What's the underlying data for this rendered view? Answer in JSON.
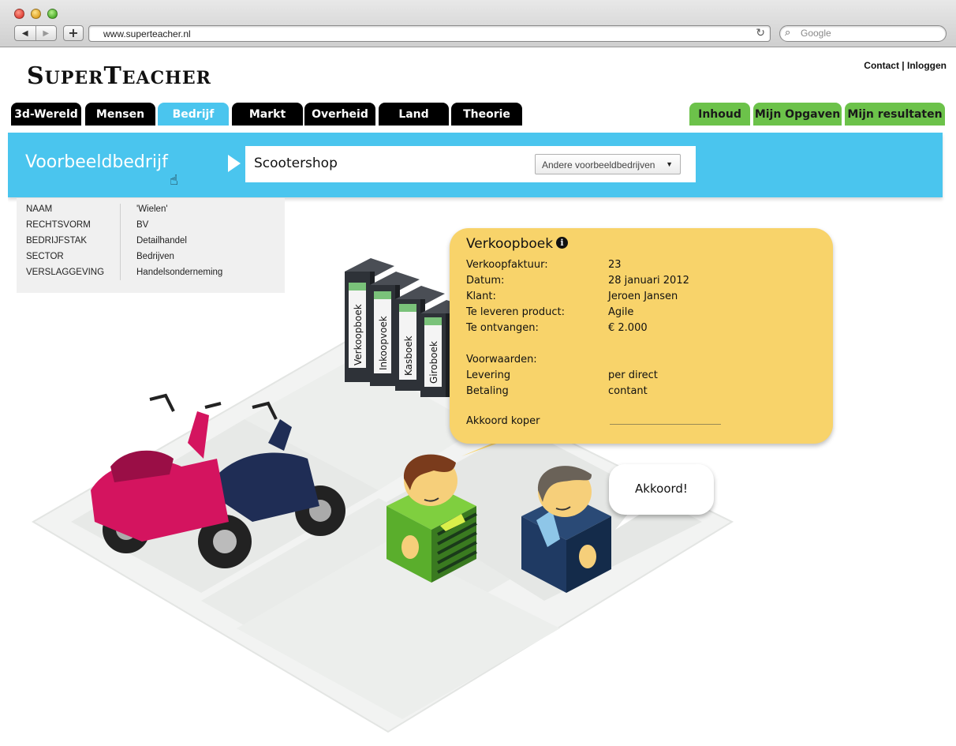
{
  "browser": {
    "url": "www.superteacher.nl",
    "search_placeholder": "Google"
  },
  "site": {
    "logo": "SuperTeacher",
    "logo_big_1": "S",
    "logo_small_1": "UPER",
    "logo_big_2": "T",
    "logo_small_2": "EACHER",
    "contact": "Contact",
    "separator": "|",
    "login": "Inloggen"
  },
  "nav": {
    "tabs": [
      {
        "label": "3d-Wereld"
      },
      {
        "label": "Mensen"
      },
      {
        "label": "Bedrijf"
      },
      {
        "label": "Markt"
      },
      {
        "label": "Overheid"
      },
      {
        "label": "Land"
      },
      {
        "label": "Theorie"
      }
    ],
    "right_tabs": [
      {
        "label": "Inhoud"
      },
      {
        "label": "Mijn Opgaven"
      },
      {
        "label": "Mijn resultaten"
      }
    ],
    "active": "Bedrijf"
  },
  "bar": {
    "title": "Voorbeeldbedrijf",
    "company": "Scootershop",
    "dropdown_selected": "Andere voorbeeldbedrijven"
  },
  "info": {
    "labels": [
      "NAAM",
      "RECHTSVORM",
      "BEDRIJFSTAK",
      "SECTOR",
      "VERSLAGGEVING"
    ],
    "values": [
      "'Wielen'",
      "BV",
      "Detailhandel",
      "Bedrijven",
      "Handelsonderneming"
    ]
  },
  "binders": [
    "Verkoopboek",
    "Inkoopvoek",
    "Kasboek",
    "Giroboek"
  ],
  "receipt": {
    "title": "Verkoopboek",
    "rows": [
      {
        "label": "Verkoopfaktuur:",
        "value": "23"
      },
      {
        "label": "Datum:",
        "value": "28 januari 2012"
      },
      {
        "label": "Klant:",
        "value": "Jeroen Jansen"
      },
      {
        "label": "Te leveren product:",
        "value": "Agile"
      },
      {
        "label": "Te ontvangen:",
        "value": "€ 2.000"
      }
    ],
    "terms_header": "Voorwaarden:",
    "terms": [
      {
        "label": "Levering",
        "value": "per direct"
      },
      {
        "label": "Betaling",
        "value": "contant"
      }
    ],
    "sign_label": "Akkoord koper"
  },
  "speech": "Akkoord!",
  "colors": {
    "accent_blue": "#4ac5ee",
    "accent_green": "#6cc24a",
    "bubble_yellow": "#f8d36a",
    "tab_black": "#000000"
  }
}
